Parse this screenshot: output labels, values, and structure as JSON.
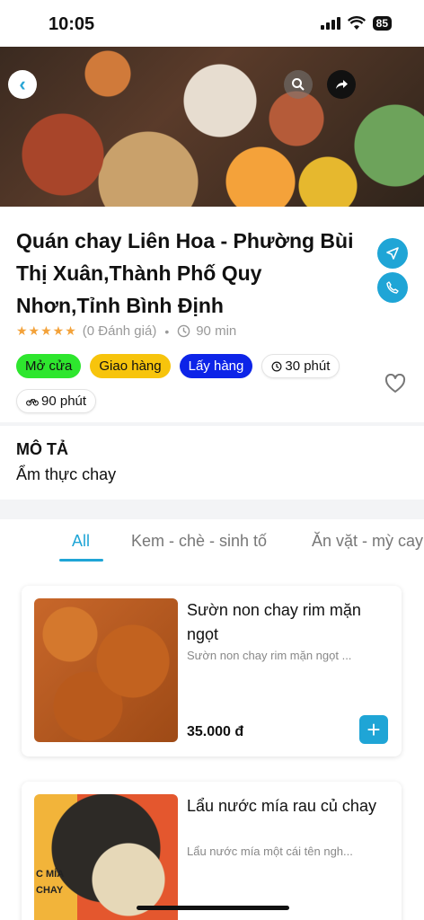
{
  "status": {
    "time": "10:05",
    "battery": "85"
  },
  "shop": {
    "title": "Quán chay Liên Hoa - Phường Bùi Thị Xuân,Thành Phố Quy Nhơn,Tỉnh Bình Định",
    "stars": "★★★★★",
    "reviews": "(0 Đánh giá)",
    "time": "90 min",
    "tags": {
      "open": "Mở cửa",
      "delivery": "Giao hàng",
      "pickup": "Lấy hàng",
      "prep_time": "30 phút",
      "ride_time": "90 phút"
    }
  },
  "description": {
    "title": "MÔ TẢ",
    "text": "Ẩm thực chay"
  },
  "tabs": [
    {
      "label": "All"
    },
    {
      "label": "Kem - chè - sinh tố"
    },
    {
      "label": "Ăn vặt - mỳ cay"
    }
  ],
  "products": [
    {
      "name": "Sườn non chay rim mặn ngọt",
      "desc": "Sườn non chay rim mặn ngọt ...",
      "price": "35.000 đ",
      "add": "+"
    },
    {
      "name": "Lẩu nước mía rau củ chay",
      "desc": "Lẩu nước mía một cái tên ngh...",
      "image_label": "C MÍA\nCHAY"
    }
  ],
  "colors": {
    "accent": "#1fa5d6",
    "open": "#2ee62e",
    "delivery": "#f7c40c",
    "pickup": "#0d24e8",
    "star": "#f3a23a"
  },
  "icons": [
    "back-icon",
    "search-icon",
    "share-icon",
    "navigate-icon",
    "phone-icon",
    "clock-icon",
    "bike-icon",
    "heart-icon",
    "plus-icon"
  ]
}
